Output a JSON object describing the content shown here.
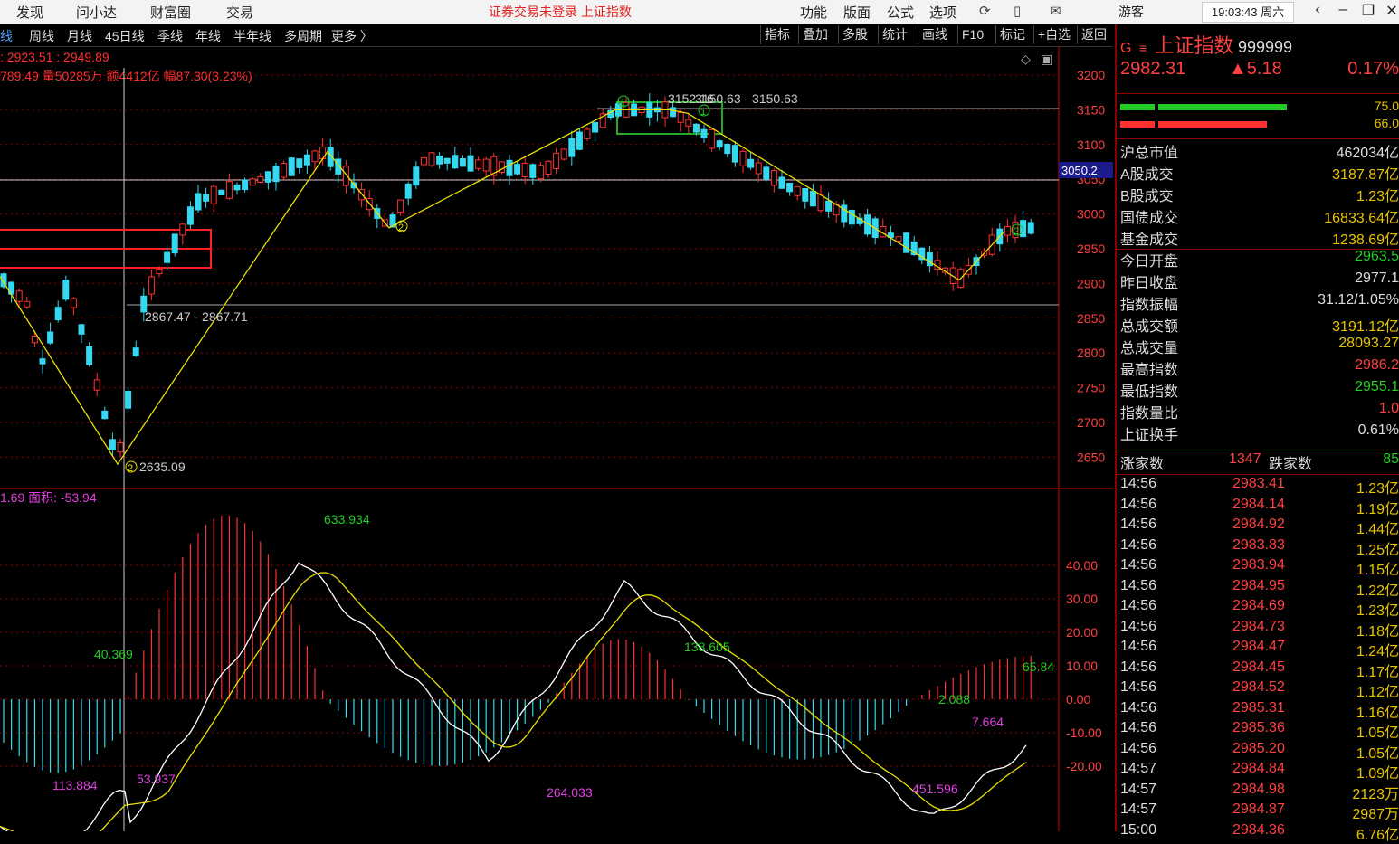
{
  "menu": {
    "items": [
      "发现",
      "问小达",
      "财富圈",
      "交易"
    ],
    "notice": "证券交易未登录  上证指数",
    "right_items": [
      "功能",
      "版面",
      "公式",
      "选项"
    ],
    "user": "游客",
    "clock": "19:03:43 周六"
  },
  "periods": [
    "日线",
    "周线",
    "月线",
    "45日线",
    "季线",
    "年线",
    "半年线",
    "多周期",
    "更多 〉"
  ],
  "toolbar": [
    "指标",
    "叠加",
    "多股",
    "统计",
    "画线",
    "F10",
    "标记",
    "+自选",
    "返回"
  ],
  "chart_info": {
    "line1": ": 2923.51 : 2949.89",
    "line2": "789.49 量50285万 额4412亿 幅87.30(3.23%)",
    "macd_info": "1.69 面积: -53.94"
  },
  "price_axis": [
    "3200",
    "3150",
    "3100",
    "3050",
    "3000",
    "2950",
    "2900",
    "2850",
    "2800",
    "2750",
    "2700",
    "2650"
  ],
  "price_marker": "3050.2",
  "annotations": {
    "high_range": "3150.63 - 3150.63",
    "high_label": "3152.16",
    "mid_range": "2867.47 - 2867.71",
    "low_label": "2635.09"
  },
  "macd_axis": [
    "40.00",
    "30.00",
    "20.00",
    "10.00",
    "0.00",
    "-10.00",
    "-20.00"
  ],
  "macd_labels": {
    "a": "633.934",
    "b": "40.369",
    "c": "138.605",
    "d": "65.84",
    "e": "2.088",
    "f": "7.664",
    "g": "113.884",
    "h": "53.937",
    "i": "264.033",
    "j": "451.596"
  },
  "panel": {
    "code_prefix": "G",
    "name": "上证指数",
    "code": "999999",
    "price": "2982.31",
    "change": "▲5.18",
    "pct": "0.17%",
    "bar_val1": "75.0",
    "bar_val2": "66.0",
    "rows": [
      {
        "k": "沪总市值",
        "v": "462034亿",
        "c": "#dddddd"
      },
      {
        "k": "A股成交",
        "v": "3187.87亿",
        "c": "#e8c400"
      },
      {
        "k": "B股成交",
        "v": "1.23亿",
        "c": "#e8c400"
      },
      {
        "k": "国债成交",
        "v": "16833.64亿",
        "c": "#e8c400"
      },
      {
        "k": "基金成交",
        "v": "1238.69亿",
        "c": "#e8c400"
      },
      {
        "k": "今日开盘",
        "v": "2963.5",
        "c": "#22cc22"
      },
      {
        "k": "昨日收盘",
        "v": "2977.1",
        "c": "#dddddd"
      },
      {
        "k": "指数振幅",
        "v": "31.12/1.05%",
        "c": "#dddddd"
      },
      {
        "k": "总成交额",
        "v": "3191.12亿",
        "c": "#e8c400"
      },
      {
        "k": "总成交量",
        "v": "28093.27",
        "c": "#e8c400"
      },
      {
        "k": "最高指数",
        "v": "2986.2",
        "c": "#ff4040"
      },
      {
        "k": "最低指数",
        "v": "2955.1",
        "c": "#22cc22"
      },
      {
        "k": "指数量比",
        "v": "1.0",
        "c": "#ff4040"
      },
      {
        "k": "上证换手",
        "v": "0.61%",
        "c": "#dddddd"
      }
    ],
    "up_label": "涨家数",
    "up_count": "1347",
    "down_label": "跌家数",
    "down_count": "85",
    "ticks": [
      {
        "t": "14:56",
        "p": "2983.41",
        "v": "1.23亿"
      },
      {
        "t": "14:56",
        "p": "2984.14",
        "v": "1.19亿"
      },
      {
        "t": "14:56",
        "p": "2984.92",
        "v": "1.44亿"
      },
      {
        "t": "14:56",
        "p": "2983.83",
        "v": "1.25亿"
      },
      {
        "t": "14:56",
        "p": "2983.94",
        "v": "1.15亿"
      },
      {
        "t": "14:56",
        "p": "2984.95",
        "v": "1.22亿"
      },
      {
        "t": "14:56",
        "p": "2984.69",
        "v": "1.23亿"
      },
      {
        "t": "14:56",
        "p": "2984.73",
        "v": "1.18亿"
      },
      {
        "t": "14:56",
        "p": "2984.47",
        "v": "1.24亿"
      },
      {
        "t": "14:56",
        "p": "2984.45",
        "v": "1.17亿"
      },
      {
        "t": "14:56",
        "p": "2984.52",
        "v": "1.12亿"
      },
      {
        "t": "14:56",
        "p": "2985.31",
        "v": "1.16亿"
      },
      {
        "t": "14:56",
        "p": "2985.36",
        "v": "1.05亿"
      },
      {
        "t": "14:56",
        "p": "2985.20",
        "v": "1.05亿"
      },
      {
        "t": "14:57",
        "p": "2984.84",
        "v": "1.09亿"
      },
      {
        "t": "14:57",
        "p": "2984.98",
        "v": "2123万"
      },
      {
        "t": "14:57",
        "p": "2984.87",
        "v": "2987万"
      },
      {
        "t": "15:00",
        "p": "2984.36",
        "v": "6.76亿"
      }
    ]
  }
}
